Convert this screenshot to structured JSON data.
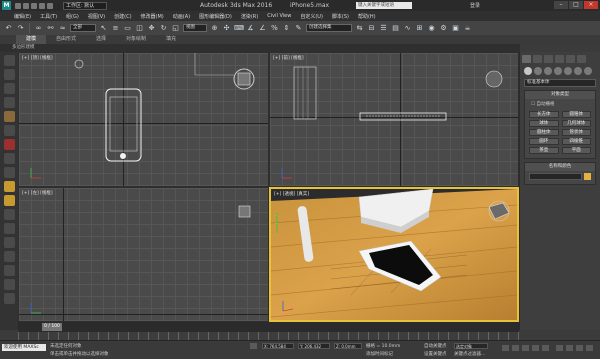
{
  "titlebar": {
    "workspace": "工作区: 默认",
    "title": "Autodesk 3ds Max 2016",
    "filename": "iPhone5.max",
    "search_placeholder": "键入关键字或短语",
    "login": "登录"
  },
  "menubar": {
    "items": [
      "编辑(E)",
      "工具(T)",
      "组(G)",
      "视图(V)",
      "创建(C)",
      "修改器(M)",
      "动画(A)",
      "图形编辑器(D)",
      "渲染(R)",
      "Civil View",
      "自定义(U)",
      "脚本(S)",
      "帮助(H)"
    ]
  },
  "toolbar": {
    "filter_value": "全部",
    "view_value": "视图",
    "selection_set": "创建选择集"
  },
  "ribbon": {
    "tabs": [
      "建模",
      "自由形式",
      "选择",
      "对象绘制",
      "填充"
    ],
    "subtitle": "多边形建模"
  },
  "viewports": {
    "top": "[+] [顶] [线框]",
    "front": "[+] [前] [线框]",
    "left": "[+] [左] [线框]",
    "persp": "[+] [透视] [真实]"
  },
  "command_panel": {
    "dropdown": "标准基本体",
    "section_object_type": "对象类型",
    "autogrid": "自动栅格",
    "buttons": [
      "长方体",
      "圆锥体",
      "球体",
      "几何球体",
      "圆柱体",
      "管状体",
      "圆环",
      "四棱锥",
      "茶壶",
      "平面"
    ],
    "section_name_color": "名称和颜色"
  },
  "timeline": {
    "frame": "0 / 100"
  },
  "statusbar": {
    "welcome": "欢迎使用 MAXSc",
    "line1": "未选定任何对象",
    "line2": "单击或单击并拖动以选择对象",
    "x_value": "X: 764.584",
    "y_value": "Y: 206.432",
    "z_value": "Z: 0.0mm",
    "grid": "栅格 = 10.0mm",
    "add_time_tag": "添加时间标记",
    "auto_key": "自动关键点",
    "selected_object": "选定对象",
    "set_key": "设置关键点",
    "key_filter": "关键点过滤器..."
  }
}
